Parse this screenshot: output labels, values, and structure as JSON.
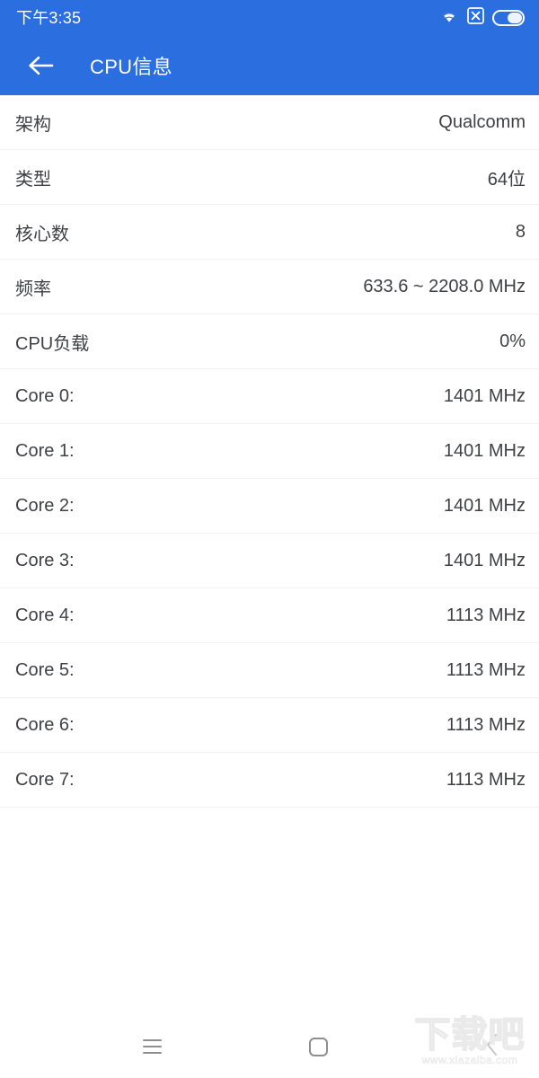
{
  "status_bar": {
    "time": "下午3:35",
    "icons": [
      "wifi-icon",
      "no-sim-icon",
      "battery-icon"
    ],
    "background_color": "#2a6ee0"
  },
  "app_bar": {
    "back_label": "back-arrow-icon",
    "title": "CPU信息",
    "background_color": "#2a6ee0",
    "text_color": "#ffffff"
  },
  "list": {
    "rows": [
      {
        "label": "架构",
        "value": "Qualcomm"
      },
      {
        "label": "类型",
        "value": "64位"
      },
      {
        "label": "核心数",
        "value": "8"
      },
      {
        "label": "频率",
        "value": "633.6 ~ 2208.0 MHz"
      },
      {
        "label": "CPU负载",
        "value": "0%"
      },
      {
        "label": "Core 0:",
        "value": "1401 MHz"
      },
      {
        "label": "Core 1:",
        "value": "1401 MHz"
      },
      {
        "label": "Core 2:",
        "value": "1401 MHz"
      },
      {
        "label": "Core 3:",
        "value": "1401 MHz"
      },
      {
        "label": "Core 4:",
        "value": "1113 MHz"
      },
      {
        "label": "Core 5:",
        "value": "1113 MHz"
      },
      {
        "label": "Core 6:",
        "value": "1113 MHz"
      },
      {
        "label": "Core 7:",
        "value": "1113 MHz"
      }
    ],
    "text_color": "#3f4145",
    "divider_color": "#f1f2f4"
  },
  "nav_bar": {
    "recents": "menu-icon",
    "home": "home-square-icon",
    "back": "chevron-left-icon"
  },
  "watermark": {
    "brand": "下载吧",
    "url": "www.xiazaiba.com"
  }
}
